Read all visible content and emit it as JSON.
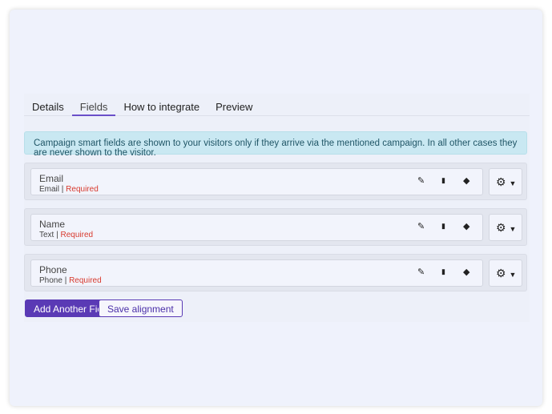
{
  "tabs": [
    {
      "label": "Details"
    },
    {
      "label": "Fields",
      "active": true
    },
    {
      "label": "How to integrate"
    },
    {
      "label": "Preview"
    }
  ],
  "alert": "Campaign smart fields are shown to your visitors only if they arrive via the mentioned campaign. In all other cases they are never shown to the visitor.",
  "fields": [
    {
      "name": "Email",
      "type": "Email",
      "sep": " | ",
      "required": "Required"
    },
    {
      "name": "Name",
      "type": "Text",
      "sep": " | ",
      "required": "Required"
    },
    {
      "name": "Phone",
      "type": "Phone",
      "sep": " | ",
      "required": "Required"
    }
  ],
  "icons": {
    "edit": "pencil-icon",
    "delete": "trash-icon",
    "tag": "tag-icon",
    "settings": "gear-icon"
  },
  "buttons": {
    "add": "Add Another Field",
    "save": "Save alignment"
  },
  "colors": {
    "accent": "#5a3ab5",
    "required": "#d83a2e",
    "alert_bg": "#c9e8f2"
  }
}
